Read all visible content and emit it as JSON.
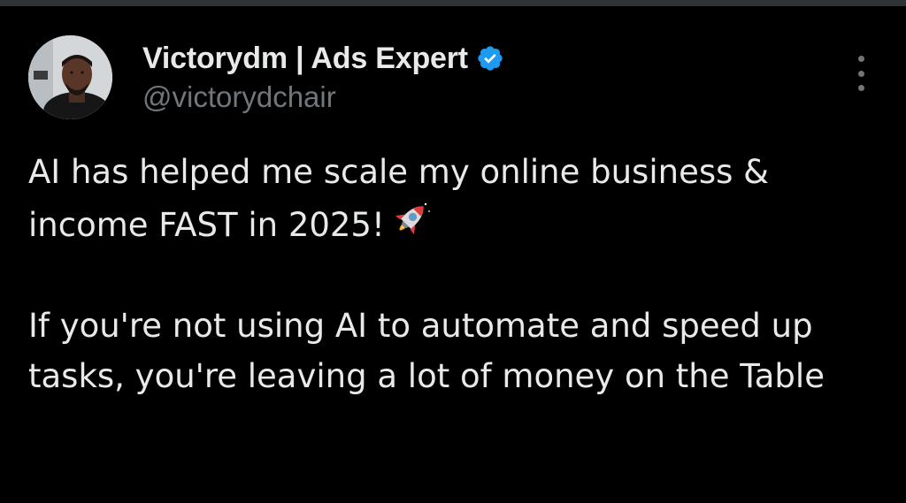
{
  "author": {
    "display_name": "Victorydm | Ads Expert",
    "handle": "@victorydchair",
    "verified": true,
    "avatar_icon": "avatar-photo",
    "verified_icon": "verified-badge-icon"
  },
  "tweet": {
    "paragraph_1": "AI has helped me scale my online business & income FAST in 2025!",
    "paragraph_1_emoji": "rocket-icon",
    "paragraph_2": "If you're not using AI to automate and speed up tasks, you're leaving a lot of money on the Table"
  },
  "menu": {
    "icon": "more-options-icon"
  },
  "colors": {
    "background": "#000000",
    "text": "#e7e9ea",
    "secondary_text": "#71767b",
    "verified": "#1d9bf0"
  }
}
